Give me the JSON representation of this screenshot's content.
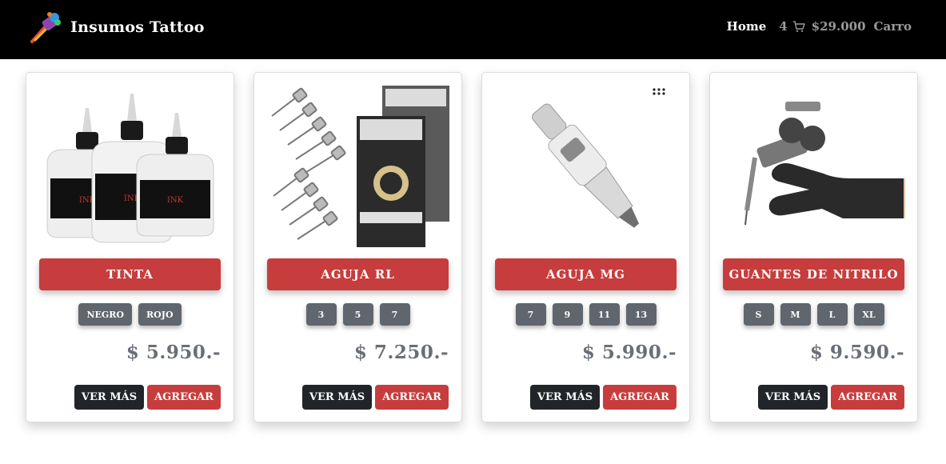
{
  "brand": {
    "name": "Insumos Tattoo",
    "logo_icon": "tattoo-machine-logo-icon"
  },
  "nav": {
    "home_label": "Home",
    "cart_count": "4",
    "cart_icon": "shopping-cart-icon",
    "cart_total": "$29.000",
    "cart_label": "Carro"
  },
  "colors": {
    "navbar": "#000000",
    "accent": "#c73d3d",
    "variant": "#5f666e",
    "dark_button": "#212529",
    "price": "#6a6f76"
  },
  "products": [
    {
      "title": "TINTA",
      "variants": [
        "NEGRO",
        "ROJO"
      ],
      "price": "$ 5.950.-",
      "view_label": "VER MÁS",
      "add_label": "AGREGAR",
      "image_icon": "ink-bottles-image"
    },
    {
      "title": "AGUJA RL",
      "variants": [
        "3",
        "5",
        "7"
      ],
      "price": "$ 7.250.-",
      "view_label": "VER MÁS",
      "add_label": "AGREGAR",
      "image_icon": "needle-cartridges-box-image"
    },
    {
      "title": "AGUJA MG",
      "variants": [
        "7",
        "9",
        "11",
        "13"
      ],
      "price": "$ 5.990.-",
      "view_label": "VER MÁS",
      "add_label": "AGREGAR",
      "image_icon": "needle-cartridge-image"
    },
    {
      "title": "GUANTES DE NITRILO",
      "variants": [
        "S",
        "M",
        "L",
        "XL"
      ],
      "price": "$ 9.590.-",
      "view_label": "VER MÁS",
      "add_label": "AGREGAR",
      "image_icon": "nitrile-glove-image"
    }
  ]
}
